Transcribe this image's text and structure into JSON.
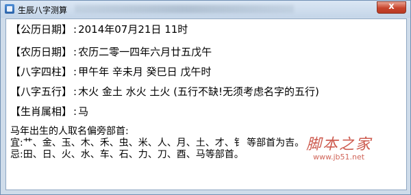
{
  "window": {
    "title": "生辰八字测算",
    "close_glyph": "x"
  },
  "lines": [
    {
      "label": "【公历日期】",
      "value": "2014年07月21日 11时"
    },
    {
      "label": "【农历日期】",
      "value": "农历二零一四年六月廿五戊午"
    },
    {
      "label": "【八字四柱】",
      "value": "甲午年 辛未月 癸巳日 戊午时"
    },
    {
      "label": "【八字五行】",
      "value": "木火 金土 水火 土火  (五行不缺!无须考虑名字的五行)"
    },
    {
      "label": "【生肖属相】",
      "value": "马"
    }
  ],
  "radicals": {
    "heading": "马年出生的人取名偏旁部首:",
    "good": "宜:艹、金、玉、木、禾、虫、米、人、月、土、才、钅 等部首为吉。",
    "bad": "忌:田、日、火、水、车、石、力、刀、酉、马等部首。"
  },
  "watermark": {
    "brand": "脚本之家",
    "url": "www.jb51.net"
  }
}
